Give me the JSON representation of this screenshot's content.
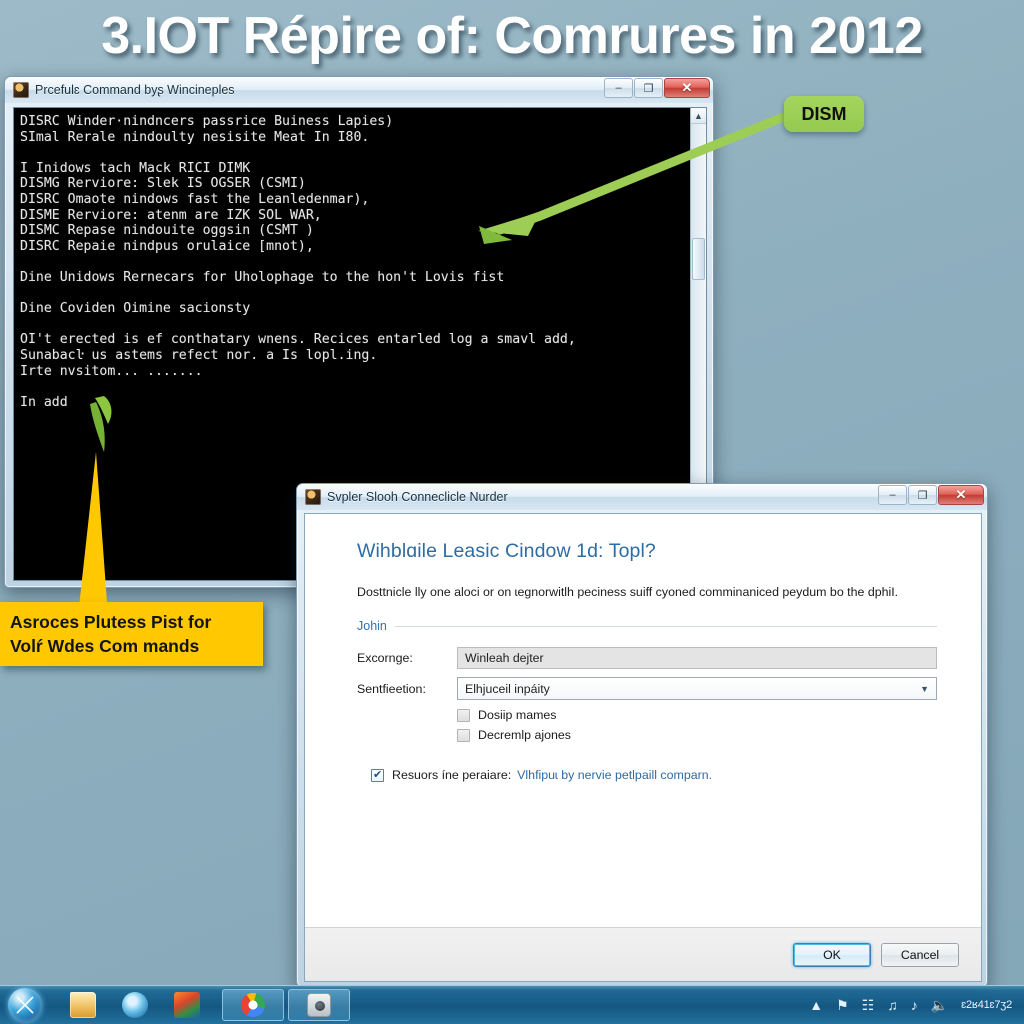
{
  "headline": "3.ΙΟΤ Répire of: Comrures in 2012",
  "desktop": {
    "background_color": "#8eafbe"
  },
  "cmd_window": {
    "title": "Prcefulɛ Command byʂ Wincineples",
    "icon": "cmd-shield-icon",
    "buttons": {
      "minimize": "–",
      "restore": "❐",
      "close": "✕"
    },
    "console_lines": [
      "DISRC Winder·nindncers passrice Buiness Lapies)",
      "SImal Rerale nindoulty nesisite Meat In I80.",
      "",
      "I Inidows tach Mack RICI DIMK",
      "DISMG Rerviore: Slek IS OGSER (CSMI)",
      "DISRC Omaote nindows fast the Leanledenmar),",
      "DISME Rerviore: atenm are IZK SOL WAR,",
      "DISMC Repase nindouite oggsin (CSMT )",
      "DISRC Repaie nindpus orulaice [mnot),",
      "",
      "Dine Unidows Rernecars for Uholophage to the hon't Lovis fist",
      "",
      "Dine Coviden Oimine sacionsty",
      "",
      "OI't erected is ef conthatary wnens. Recices entarled log a smavl add,",
      "Sunabacŀ us astems refect nor. a Is lopl.ing.",
      "Irte nvsitom... .......",
      "",
      "In add"
    ],
    "scrollbar": {
      "up_arrow": "▲",
      "down_arrow": "▼"
    }
  },
  "dialog": {
    "title": "Svpler Slooh Conneclicle Nurder",
    "icon": "app-shield-icon",
    "buttons": {
      "minimize": "–",
      "restore": "❐",
      "close": "✕"
    },
    "heading": "Wihblɑile Leasic Cindow 1d: Topl?",
    "description": "Dosttnicle lly one aloci or on ɩegnorwitlh peciness suiff cyoned comminaniced peydum bo the dphiI.",
    "group_label": "Johin",
    "fields": [
      {
        "label": "Excornge:",
        "type": "text",
        "value": "Winleah dejter",
        "readonly": true
      },
      {
        "label": "Sentfieetion:",
        "type": "select",
        "value": "Elhjuceil inpáity"
      }
    ],
    "checkboxes": [
      {
        "label": "Dosiip mames",
        "checked": false
      },
      {
        "label": "Decremlp ajones",
        "checked": false
      }
    ],
    "bottom_option": {
      "checked": true,
      "label": "Resuors íne peraiare:",
      "link": "Vlhfipuɩ by nervie petlpaill comparn."
    },
    "footer": {
      "ok": "OK",
      "cancel": "Cancel"
    }
  },
  "callouts": {
    "dism": {
      "text": "DISM",
      "color": "#9ecd55"
    },
    "yellow": {
      "line1": "Asroces Plutess Pist for",
      "line2": "Volŕ Wdes Com mands",
      "color": "#ffc800"
    }
  },
  "taskbar": {
    "start_label": "start-orb",
    "quick_launch": [
      "folder-icon",
      "ie-icon",
      "media-center-icon"
    ],
    "task_buttons": [
      "chrome-icon",
      "camera-icon"
    ],
    "tray_icons": [
      "show-hidden-chevron",
      "flag-icon",
      "network-icon",
      "headphone-icon",
      "note-icon",
      "volume-mute-icon"
    ],
    "clock": "ɛ2ʁ41ɛ7ʒ2"
  }
}
